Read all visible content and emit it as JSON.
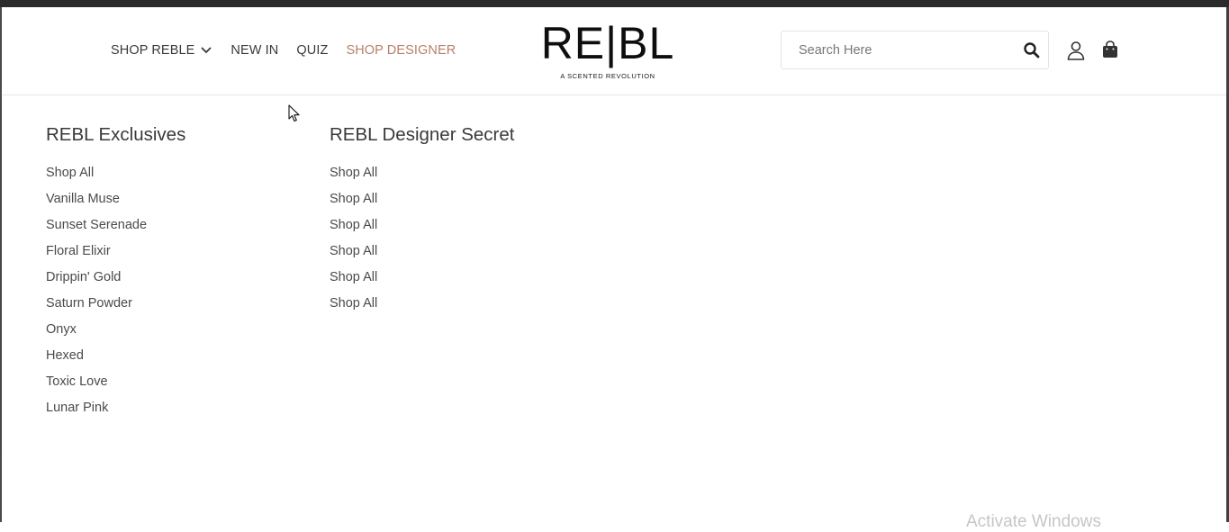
{
  "nav": {
    "items": [
      {
        "label": "SHOP REBLE",
        "has_dropdown": true
      },
      {
        "label": "NEW IN"
      },
      {
        "label": "QUIZ"
      },
      {
        "label": "SHOP DESIGNER",
        "accent": "#b77f6a"
      }
    ]
  },
  "logo": {
    "mark": "RE|BL",
    "tagline": "A SCENTED REVOLUTION"
  },
  "search": {
    "placeholder": "Search Here",
    "value": ""
  },
  "icons": {
    "search": "search-icon",
    "account": "user-icon",
    "cart": "bag-icon"
  },
  "mega_menu": {
    "columns": [
      {
        "title": "REBL Exclusives",
        "items": [
          "Shop All",
          "Vanilla Muse",
          "Sunset Serenade",
          "Floral Elixir",
          "Drippin' Gold",
          "Saturn Powder",
          "Onyx",
          "Hexed",
          "Toxic Love",
          "Lunar Pink"
        ]
      },
      {
        "title": "REBL Designer Secret",
        "items": [
          "Shop All",
          "Shop All",
          "Shop All",
          "Shop All",
          "Shop All",
          "Shop All"
        ]
      }
    ]
  },
  "watermark": "Activate Windows",
  "colors": {
    "accent": "#b77f6a",
    "text": "#3a3a3a",
    "frame": "#2b2b2b"
  }
}
